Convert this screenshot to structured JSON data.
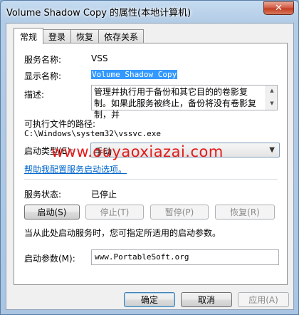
{
  "window": {
    "title": "Volume Shadow Copy 的属性(本地计算机)",
    "close_glyph": "✕"
  },
  "tabs": [
    {
      "label": "常规",
      "active": true
    },
    {
      "label": "登录",
      "active": false
    },
    {
      "label": "恢复",
      "active": false
    },
    {
      "label": "依存关系",
      "active": false
    }
  ],
  "general": {
    "service_name_label": "服务名称:",
    "service_name": "VSS",
    "display_name_label": "显示名称:",
    "display_name": "Volume Shadow Copy",
    "description_label": "描述:",
    "description": "管理并执行用于备份和其它目的的卷影复制。如果此服务被终止，备份将没有卷影复制，并",
    "exe_path_label": "可执行文件的路径:",
    "exe_path": "C:\\Windows\\system32\\vssvc.exe",
    "startup_type_label": "启动类型(E):",
    "startup_type": "手动",
    "help_link": "帮助我配置服务启动选项。",
    "watermark": "www.ouyaoxiazai.com",
    "status_label": "服务状态:",
    "status_value": "已停止",
    "buttons": {
      "start": "启动(S)",
      "stop": "停止(T)",
      "pause": "暂停(P)",
      "resume": "恢复(R)"
    },
    "hint": "当从此处启动服务时，您可指定所适用的启动参数。",
    "params_label": "启动参数(M):",
    "params_value": "www.PortableSoft.org"
  },
  "footer": {
    "ok": "确定",
    "cancel": "取消",
    "apply": "应用(A)"
  },
  "colors": {
    "selection": "#3399ff",
    "link": "#0066cc",
    "watermark": "#e21a1a"
  }
}
